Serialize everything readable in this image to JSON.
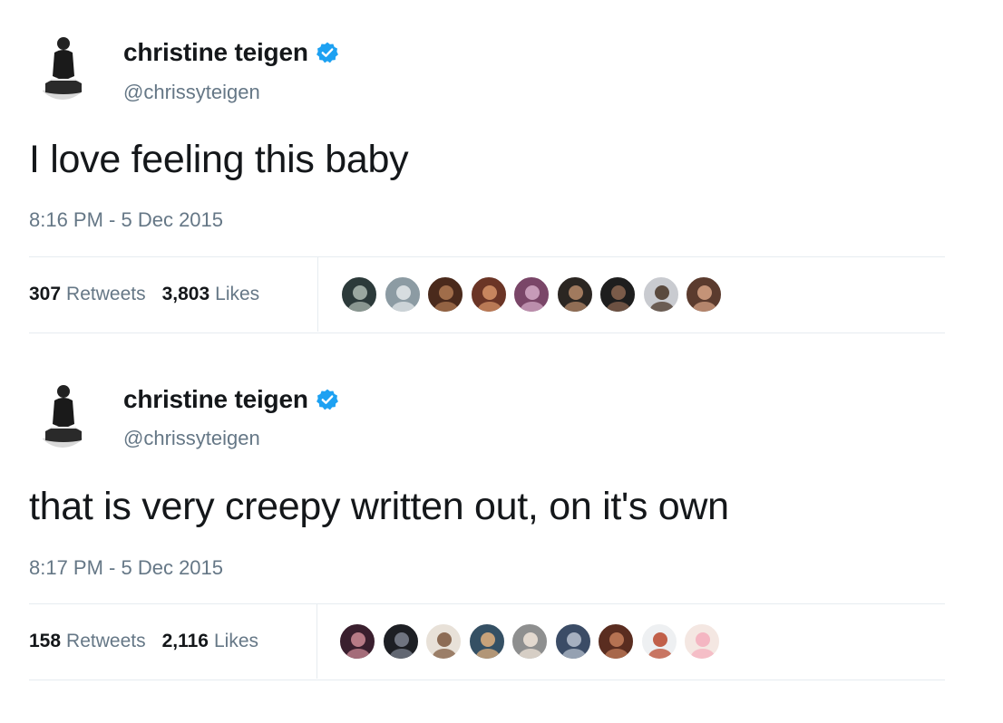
{
  "tweets": [
    {
      "display_name": "christine teigen",
      "verified": true,
      "handle": "@chrissyteigen",
      "text": "I love feeling this baby",
      "timestamp": "8:16 PM - 5 Dec 2015",
      "retweets_count": "307",
      "retweets_label": "Retweets",
      "likes_count": "3,803",
      "likes_label": "Likes",
      "liker_avatars": [
        {
          "bg": "#2c3a3a",
          "fg": "#9aa7a0"
        },
        {
          "bg": "#8c9ba3",
          "fg": "#d7dde0"
        },
        {
          "bg": "#4a2a1c",
          "fg": "#a06d4a"
        },
        {
          "bg": "#6b3526",
          "fg": "#c7855e"
        },
        {
          "bg": "#7a4668",
          "fg": "#c79bb8"
        },
        {
          "bg": "#2b2622",
          "fg": "#a17a5e"
        },
        {
          "bg": "#1e1e1e",
          "fg": "#7a5b49"
        },
        {
          "bg": "#c9cbd0",
          "fg": "#5a4a3e"
        },
        {
          "bg": "#5b3b2e",
          "fg": "#c49377"
        }
      ]
    },
    {
      "display_name": "christine teigen",
      "verified": true,
      "handle": "@chrissyteigen",
      "text": "that is very creepy written out, on it's own",
      "timestamp": "8:17 PM - 5 Dec 2015",
      "retweets_count": "158",
      "retweets_label": "Retweets",
      "likes_count": "2,116",
      "likes_label": "Likes",
      "liker_avatars": [
        {
          "bg": "#3a1f2e",
          "fg": "#b77a86"
        },
        {
          "bg": "#1d1f24",
          "fg": "#6f7480"
        },
        {
          "bg": "#e8e1d8",
          "fg": "#8d6c55"
        },
        {
          "bg": "#355064",
          "fg": "#c8a27a"
        },
        {
          "bg": "#8e8f8f",
          "fg": "#e3d9cf"
        },
        {
          "bg": "#3b4c66",
          "fg": "#a6b0c0"
        },
        {
          "bg": "#5a2d20",
          "fg": "#b57252"
        },
        {
          "bg": "#eef0f2",
          "fg": "#c1604a"
        },
        {
          "bg": "#f4e7e2",
          "fg": "#f4b6c2"
        }
      ]
    }
  ],
  "colors": {
    "text_primary": "#14171a",
    "text_secondary": "#657786",
    "verified_blue": "#1da1f2",
    "divider": "#e6ecf0"
  },
  "icons": {
    "verified": "verified-badge-icon"
  }
}
